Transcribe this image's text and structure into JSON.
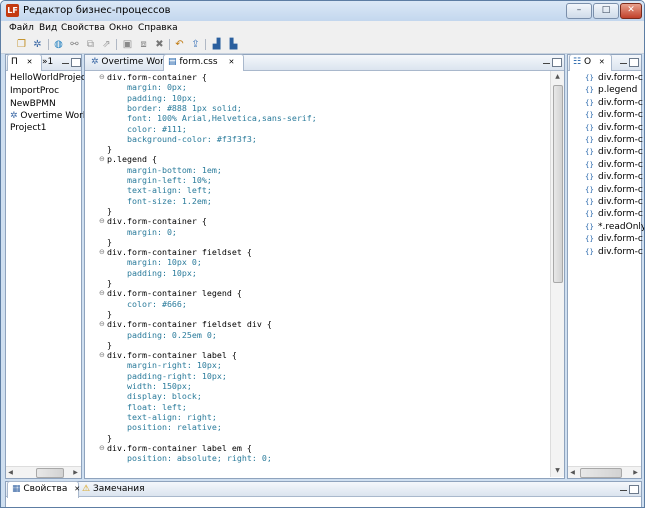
{
  "window": {
    "title": "Редактор бизнес-процессов",
    "app_icon_text": "LF",
    "min_label": "–",
    "max_label": "□",
    "close_label": "✕"
  },
  "menu": [
    "Файл",
    "Вид",
    "Свойства",
    "Окно",
    "Справка"
  ],
  "left_panel": {
    "tabs": [
      {
        "label": "П",
        "close": "✕"
      },
      {
        "label": "»1",
        "close": ""
      }
    ],
    "projects": [
      {
        "label": "HelloWorldProject",
        "icon": ""
      },
      {
        "label": "ImportProc",
        "icon": ""
      },
      {
        "label": "NewBPMN",
        "icon": ""
      },
      {
        "label": "Overtime Work",
        "icon": "gear-icon"
      },
      {
        "label": "Project1",
        "icon": ""
      }
    ]
  },
  "editor": {
    "tabs": [
      {
        "label": "Overtime Work",
        "active": false,
        "close": ""
      },
      {
        "label": "form.css",
        "active": true,
        "close": "✕"
      }
    ],
    "lines": [
      {
        "text": "div.form-container {",
        "kind": "sel",
        "fold": "⊖"
      },
      {
        "text": "    margin: 0px;",
        "kind": "prop",
        "fold": ""
      },
      {
        "text": "    padding: 10px;",
        "kind": "prop",
        "fold": ""
      },
      {
        "text": "    border: #888 1px solid;",
        "kind": "prop",
        "fold": ""
      },
      {
        "text": "    font: 100% Arial,Helvetica,sans-serif;",
        "kind": "prop",
        "fold": ""
      },
      {
        "text": "    color: #111;",
        "kind": "prop",
        "fold": ""
      },
      {
        "text": "    background-color: #f3f3f3;",
        "kind": "prop",
        "fold": ""
      },
      {
        "text": "}",
        "kind": "brace",
        "fold": ""
      },
      {
        "text": "p.legend {",
        "kind": "sel",
        "fold": "⊖"
      },
      {
        "text": "    margin-bottom: 1em;",
        "kind": "prop",
        "fold": ""
      },
      {
        "text": "    margin-left: 10%;",
        "kind": "prop",
        "fold": ""
      },
      {
        "text": "    text-align: left;",
        "kind": "prop",
        "fold": ""
      },
      {
        "text": "    font-size: 1.2em;",
        "kind": "prop",
        "fold": ""
      },
      {
        "text": "}",
        "kind": "brace",
        "fold": ""
      },
      {
        "text": "div.form-container {",
        "kind": "sel",
        "fold": "⊖"
      },
      {
        "text": "    margin: 0;",
        "kind": "prop",
        "fold": ""
      },
      {
        "text": "}",
        "kind": "brace",
        "fold": ""
      },
      {
        "text": "div.form-container fieldset {",
        "kind": "sel",
        "fold": "⊖"
      },
      {
        "text": "    margin: 10px 0;",
        "kind": "prop",
        "fold": ""
      },
      {
        "text": "    padding: 10px;",
        "kind": "prop",
        "fold": ""
      },
      {
        "text": "}",
        "kind": "brace",
        "fold": ""
      },
      {
        "text": "div.form-container legend {",
        "kind": "sel",
        "fold": "⊖"
      },
      {
        "text": "    color: #666;",
        "kind": "prop",
        "fold": ""
      },
      {
        "text": "}",
        "kind": "brace",
        "fold": ""
      },
      {
        "text": "div.form-container fieldset div {",
        "kind": "sel",
        "fold": "⊖"
      },
      {
        "text": "    padding: 0.25em 0;",
        "kind": "prop",
        "fold": ""
      },
      {
        "text": "}",
        "kind": "brace",
        "fold": ""
      },
      {
        "text": "div.form-container label {",
        "kind": "sel",
        "fold": "⊖"
      },
      {
        "text": "    margin-right: 10px;",
        "kind": "prop",
        "fold": ""
      },
      {
        "text": "    padding-right: 10px;",
        "kind": "prop",
        "fold": ""
      },
      {
        "text": "    width: 150px;",
        "kind": "prop",
        "fold": ""
      },
      {
        "text": "    display: block;",
        "kind": "prop",
        "fold": ""
      },
      {
        "text": "    float: left;",
        "kind": "prop",
        "fold": ""
      },
      {
        "text": "    text-align: right;",
        "kind": "prop",
        "fold": ""
      },
      {
        "text": "    position: relative;",
        "kind": "prop",
        "fold": ""
      },
      {
        "text": "}",
        "kind": "brace",
        "fold": ""
      },
      {
        "text": "div.form-container label em {",
        "kind": "sel",
        "fold": "⊖"
      },
      {
        "text": "    position: absolute; right: 0;",
        "kind": "prop",
        "fold": ""
      }
    ]
  },
  "outline": {
    "tab_label": "O",
    "tab_close": "✕",
    "items": [
      "div.form-c",
      "p.legend",
      "div.form-c",
      "div.form-c",
      "div.form-c",
      "div.form-c",
      "div.form-c",
      "div.form-c",
      "div.form-c",
      "div.form-c",
      "div.form-c",
      "div.form-c",
      "*.readOnly",
      "div.form-c",
      "div.form-c"
    ]
  },
  "bottom": {
    "tabs": [
      {
        "label": "Свойства",
        "close": "✕"
      },
      {
        "label": "Замечания",
        "close": ""
      }
    ]
  },
  "colors": {
    "selector": "#000000",
    "property": "#2a7b9b",
    "accent": "#1c5fa8"
  }
}
